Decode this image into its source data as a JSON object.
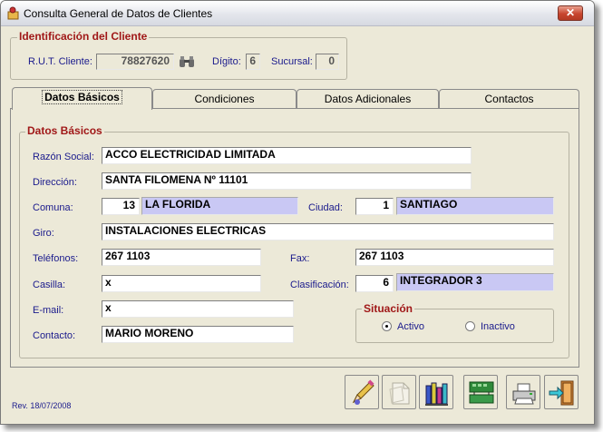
{
  "window": {
    "title": "Consulta General de Datos de Clientes",
    "close_symbol": "✕"
  },
  "identificacion": {
    "legend": "Identificación del Cliente",
    "rut_label": "R.U.T. Cliente:",
    "rut_value": "78827620",
    "digito_label": "Dígito:",
    "digito_value": "6",
    "sucursal_label": "Sucursal:",
    "sucursal_value": "0"
  },
  "tabs": [
    {
      "label": "Datos Básicos"
    },
    {
      "label": "Condiciones"
    },
    {
      "label": "Datos Adicionales"
    },
    {
      "label": "Contactos"
    }
  ],
  "datos_basicos": {
    "legend": "Datos Básicos",
    "razon_social_label": "Razón Social:",
    "razon_social_value": "ACCO ELECTRICIDAD LIMITADA",
    "direccion_label": "Dirección:",
    "direccion_value": "SANTA FILOMENA Nº 11101",
    "comuna_label": "Comuna:",
    "comuna_code": "13",
    "comuna_name": "LA FLORIDA",
    "ciudad_label": "Ciudad:",
    "ciudad_code": "1",
    "ciudad_name": "SANTIAGO",
    "giro_label": "Giro:",
    "giro_value": "INSTALACIONES ELECTRICAS",
    "telefonos_label": "Teléfonos:",
    "telefonos_value": "267 1103",
    "fax_label": "Fax:",
    "fax_value": "267 1103",
    "casilla_label": "Casilla:",
    "casilla_value": "x",
    "clasificacion_label": "Clasificación:",
    "clasificacion_code": "6",
    "clasificacion_name": "INTEGRADOR 3",
    "email_label": "E-mail:",
    "email_value": "x",
    "contacto_label": "Contacto:",
    "contacto_value": "MARIO MORENO"
  },
  "situacion": {
    "legend": "Situación",
    "activo_label": "Activo",
    "inactivo_label": "Inactivo",
    "selected": "Activo"
  },
  "footer": {
    "revision": "Rev. 18/07/2008"
  },
  "toolbar": {
    "icons": [
      "edit-pencil-icon",
      "document-disabled-icon",
      "books-icon",
      "network-icon",
      "printer-icon",
      "exit-door-icon"
    ]
  },
  "colors": {
    "legend_red": "#a01818",
    "label_blue": "#1a1a8c",
    "lookup_fill": "#c9c8f4"
  }
}
